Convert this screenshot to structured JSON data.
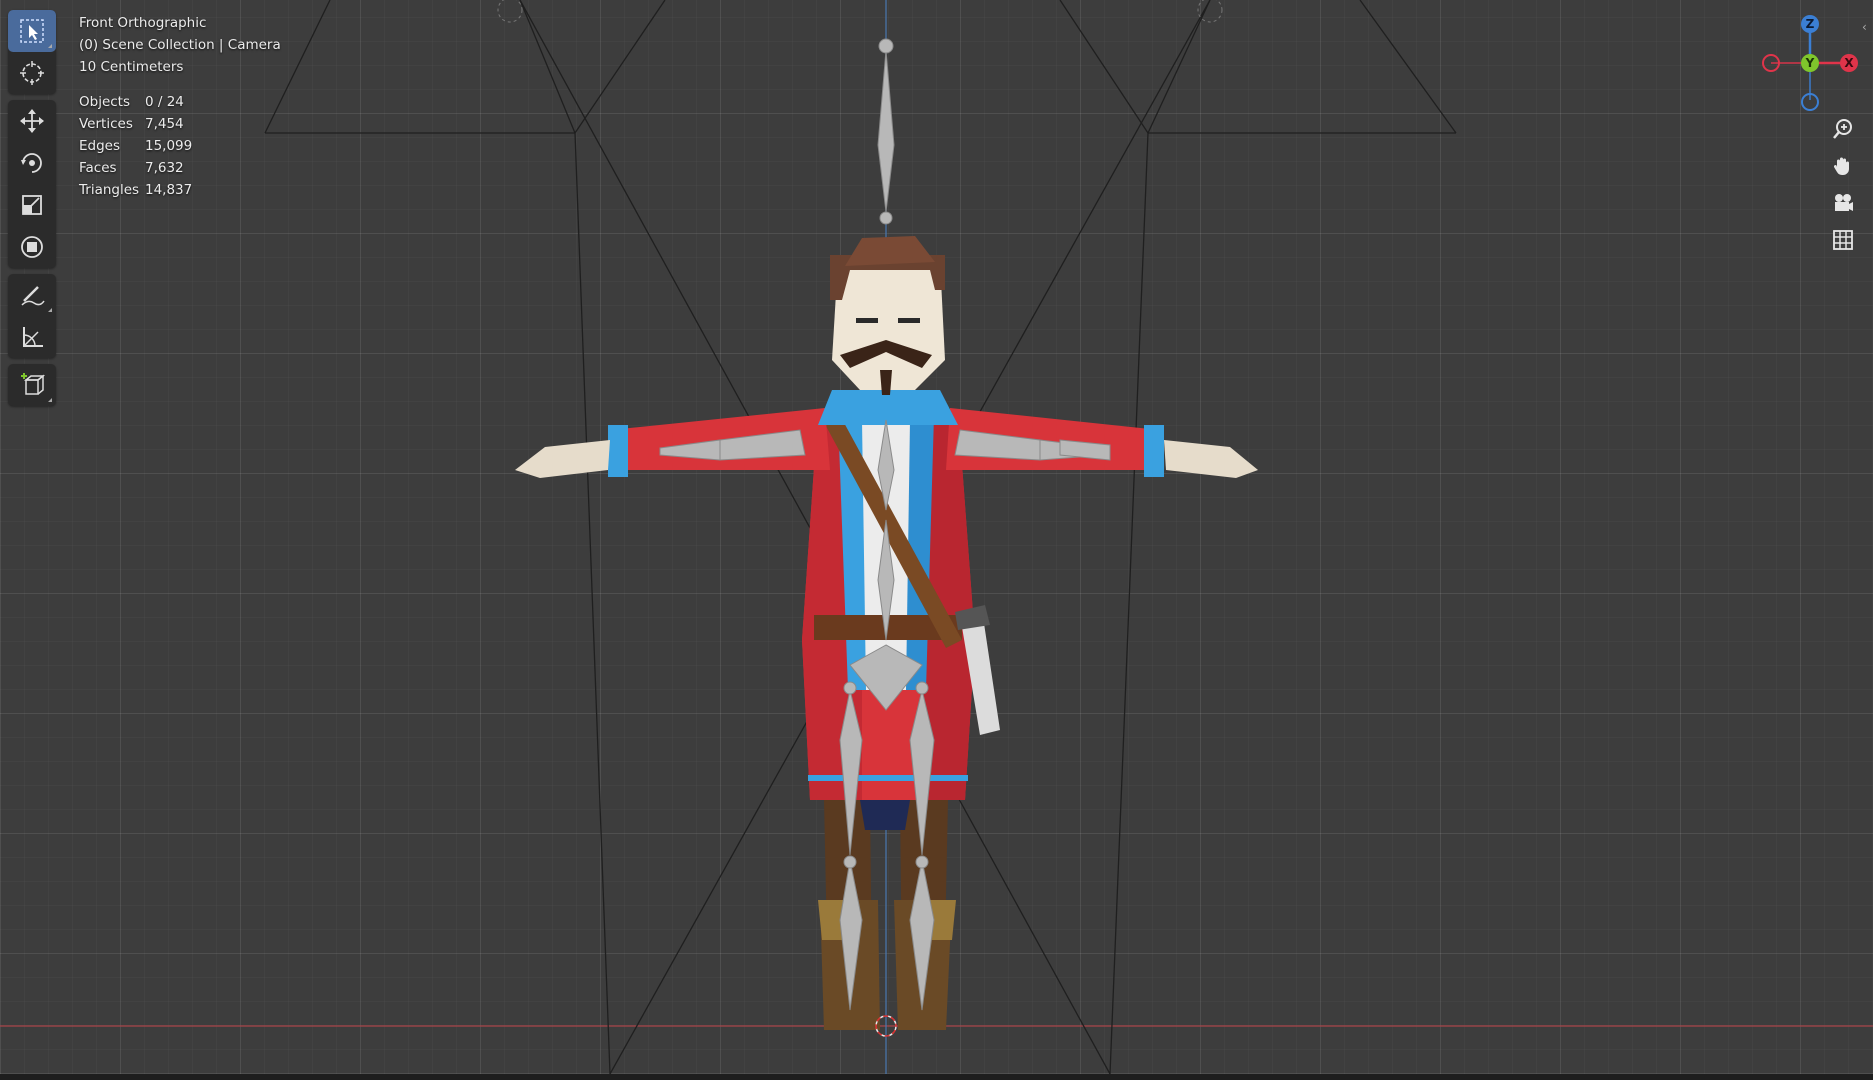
{
  "viewport": {
    "view_name": "Front Orthographic",
    "collection": "(0) Scene Collection | Camera",
    "units": "10 Centimeters"
  },
  "stats": [
    {
      "label": "Objects",
      "value": "0 / 24"
    },
    {
      "label": "Vertices",
      "value": "7,454"
    },
    {
      "label": "Edges",
      "value": "15,099"
    },
    {
      "label": "Faces",
      "value": "7,632"
    },
    {
      "label": "Triangles",
      "value": "14,837"
    }
  ],
  "toolbar": {
    "tools": [
      {
        "name": "select-box-tool",
        "icon": "select-box-icon",
        "active": true
      },
      {
        "name": "cursor-tool",
        "icon": "cursor-icon",
        "active": false
      },
      {
        "name": "move-tool",
        "icon": "move-icon",
        "active": false
      },
      {
        "name": "rotate-tool",
        "icon": "rotate-icon",
        "active": false
      },
      {
        "name": "scale-tool",
        "icon": "scale-icon",
        "active": false
      },
      {
        "name": "transform-tool",
        "icon": "transform-icon",
        "active": false
      },
      {
        "name": "annotate-tool",
        "icon": "annotate-icon",
        "active": false
      },
      {
        "name": "measure-tool",
        "icon": "measure-icon",
        "active": false
      },
      {
        "name": "add-cube-tool",
        "icon": "add-cube-icon",
        "active": false
      }
    ]
  },
  "gizmo": {
    "z_label": "Z",
    "y_label": "Y",
    "x_label": "X",
    "colors": {
      "x": "#e0344a",
      "y": "#7fc62c",
      "z": "#3b7fd4"
    }
  },
  "nav_buttons": [
    "zoom-icon",
    "pan-hand-icon",
    "camera-view-icon",
    "grid-toggle-icon"
  ],
  "colors": {
    "background": "#3d3d3d",
    "active_tool": "#4a6b9c",
    "coat_red": "#d8343a",
    "coat_blue": "#3aa1e0",
    "bone": "#b8b8b8"
  }
}
